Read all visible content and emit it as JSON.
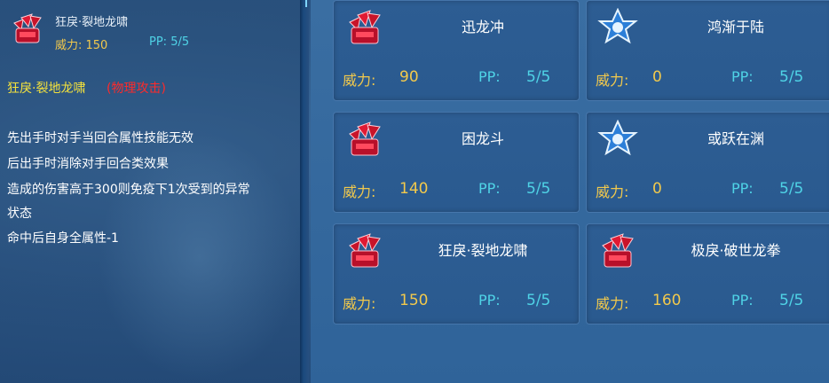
{
  "detail": {
    "name": "狂戾·裂地龙啸",
    "power_text": "威力: 150",
    "pp_text": "PP: 5/5",
    "title": "狂戾·裂地龙啸",
    "tag": "(物理攻击)",
    "desc_lines": [
      "先出手时对手当回合属性技能无效",
      "后出手时消除对手回合类效果",
      "造成的伤害高于300则免疫下1次受到的异常",
      "状态",
      "命中后自身全属性-1"
    ],
    "icon": "red-dragon-claw-icon"
  },
  "labels": {
    "power": "威力:",
    "pp": "PP:"
  },
  "skills": [
    {
      "name": "迅龙冲",
      "power": "90",
      "pp": "5/5",
      "icon": "red-dragon-claw-icon"
    },
    {
      "name": "鸿渐于陆",
      "power": "0",
      "pp": "5/5",
      "icon": "blue-star-icon"
    },
    {
      "name": "困龙斗",
      "power": "140",
      "pp": "5/5",
      "icon": "red-dragon-claw-icon"
    },
    {
      "name": "或跃在渊",
      "power": "0",
      "pp": "5/5",
      "icon": "blue-star-icon"
    },
    {
      "name": "狂戾·裂地龙啸",
      "power": "150",
      "pp": "5/5",
      "icon": "red-dragon-claw-icon"
    },
    {
      "name": "极戾·破世龙拳",
      "power": "160",
      "pp": "5/5",
      "icon": "red-dragon-claw-icon"
    }
  ],
  "colors": {
    "power": "#f2c94c",
    "pp": "#4fd3e6",
    "title": "#f5e23c",
    "tag": "#ff2a2a"
  }
}
